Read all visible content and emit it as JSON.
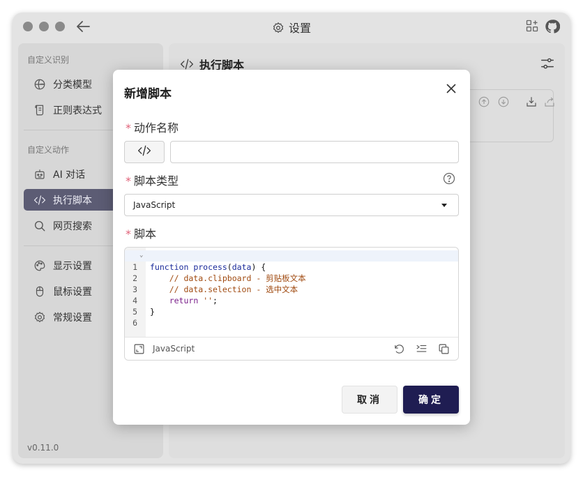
{
  "window": {
    "title": "设置",
    "icons": [
      "back-arrow-icon",
      "gear-icon",
      "add-grid-icon",
      "github-icon"
    ]
  },
  "sidebar": {
    "section_recognition": "自定义识别",
    "items_recognition": [
      {
        "label": "分类模型",
        "icon": "globe-icon"
      },
      {
        "label": "正则表达式",
        "icon": "scroll-icon"
      }
    ],
    "section_actions": "自定义动作",
    "items_actions": [
      {
        "label": "AI 对话",
        "icon": "robot-icon"
      },
      {
        "label": "执行脚本",
        "icon": "code-icon",
        "active": true
      },
      {
        "label": "网页搜索",
        "icon": "search-icon"
      }
    ],
    "items_settings": [
      {
        "label": "显示设置",
        "icon": "palette-icon"
      },
      {
        "label": "鼠标设置",
        "icon": "mouse-icon"
      },
      {
        "label": "常规设置",
        "icon": "gear-icon"
      }
    ],
    "version": "v0.11.0"
  },
  "main": {
    "title": "执行脚本",
    "icons": [
      "sliders-icon",
      "upload-icon",
      "download-icon",
      "import-icon",
      "share-icon"
    ]
  },
  "dialog": {
    "title": "新增脚本",
    "name_label": "动作名称",
    "name_value": "",
    "type_label": "脚本类型",
    "type_value": "JavaScript",
    "script_label": "脚本",
    "editor_language": "JavaScript",
    "code_lines": [
      {
        "n": "1",
        "text": "function process(data) {"
      },
      {
        "n": "2",
        "text": "    // data.clipboard - 剪贴板文本"
      },
      {
        "n": "3",
        "text": "    // data.selection - 选中文本"
      },
      {
        "n": "4",
        "text": "    return '';"
      },
      {
        "n": "5",
        "text": "}"
      },
      {
        "n": "6",
        "text": ""
      }
    ],
    "cancel_label": "取消",
    "ok_label": "确定"
  }
}
